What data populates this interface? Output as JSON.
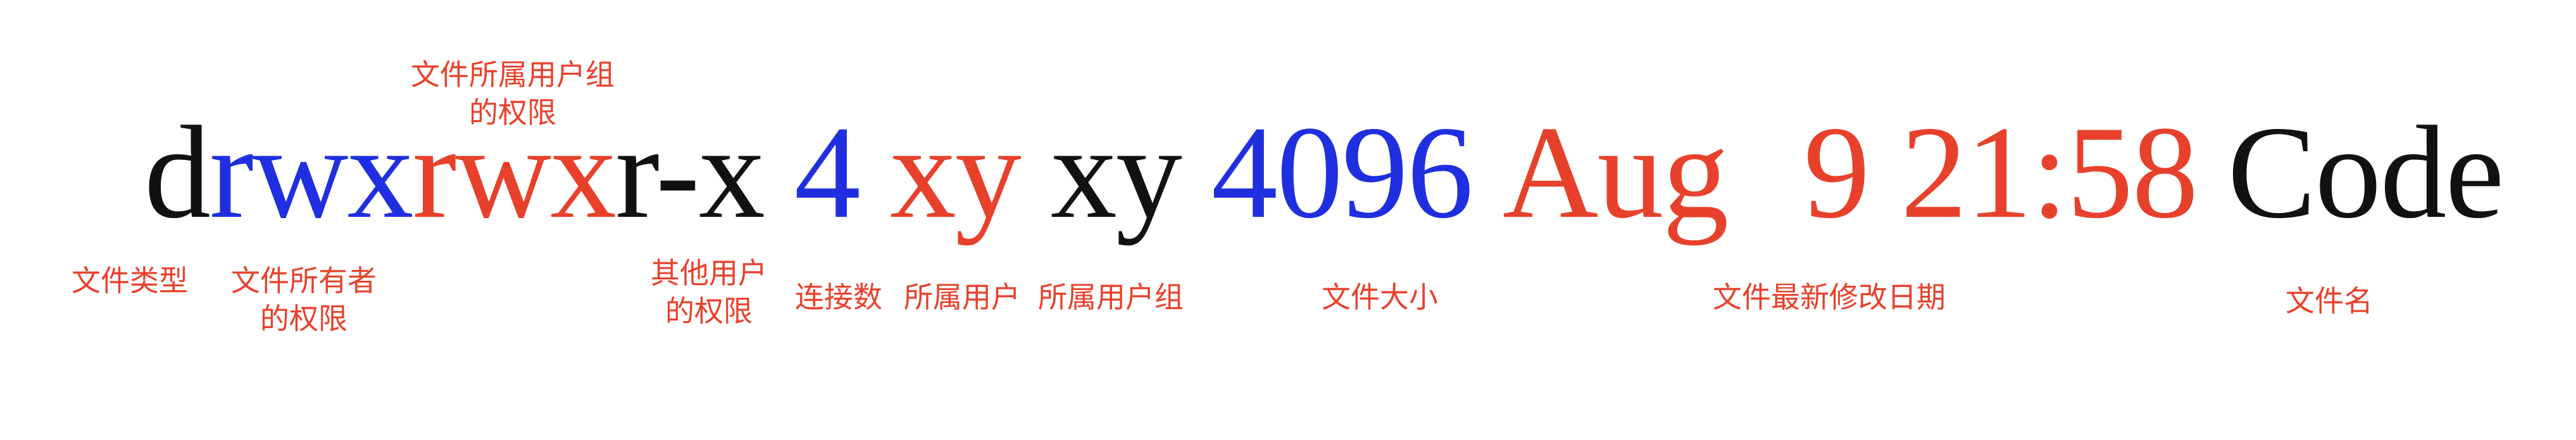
{
  "colors": {
    "black": "#111111",
    "blue": "#1f2fe0",
    "red": "#e8412b",
    "label_red": "#e8412b"
  },
  "listing": {
    "type_char": "d",
    "owner_perm": "rwx",
    "group_perm": "rwx",
    "other_perm": "r-x",
    "links": "4",
    "owner": "xy",
    "group": "xy",
    "size": "4096",
    "month": "Aug",
    "date_time": "9 21:58",
    "name": "Code"
  },
  "labels": {
    "group_perm_line1": "文件所属用户组",
    "group_perm_line2": "的权限",
    "file_type": "文件类型",
    "owner_perm_line1": "文件所有者",
    "owner_perm_line2": "的权限",
    "other_perm_line1": "其他用户",
    "other_perm_line2": "的权限",
    "links": "连接数",
    "owner": "所属用户",
    "group": "所属用户组",
    "size": "文件大小",
    "mtime": "文件最新修改日期",
    "name": "文件名"
  }
}
